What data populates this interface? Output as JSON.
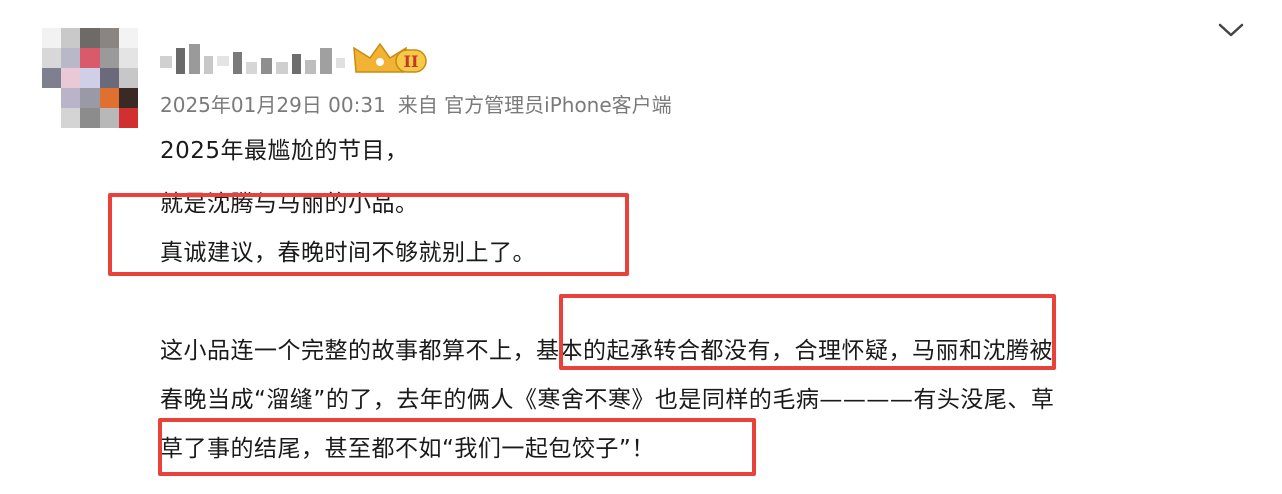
{
  "post": {
    "timestamp": "2025年01月29日 00:31",
    "source": "来自 官方管理员iPhone客户端",
    "badge_text": "II",
    "lines": [
      "2025年最尴尬的节目，",
      "就是沈腾与马丽的小品。",
      "真诚建议，春晚时间不够就别上了。",
      "这小品连一个完整的故事都算不上，基本的起承转合都没有，合理怀疑，马丽和沈腾被",
      "春晚当成“溜缝”的了，去年的俩人《寒舍不寒》也是同样的毛病————有头没尾、草",
      "草了事的结尾，甚至都不如“我们一起包饺子”！"
    ]
  },
  "colors": {
    "highlight_box": "#e8423a",
    "meta_text": "#7a7a7a",
    "crown_gold": "#f2b233",
    "badge_bg": "#f7c948"
  },
  "icons": {
    "menu": "chevron-down-icon",
    "vip": "crown-icon"
  }
}
